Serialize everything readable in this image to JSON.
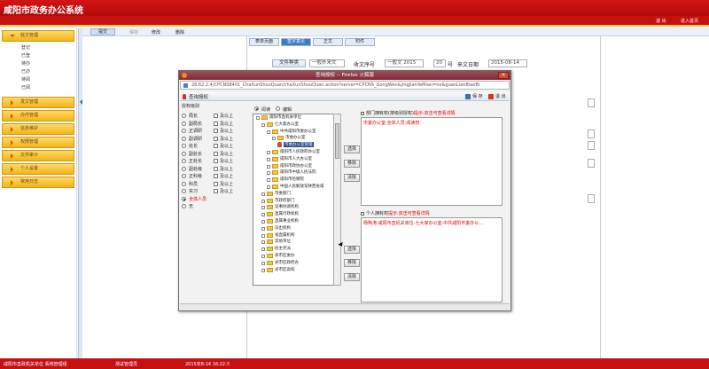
{
  "header": {
    "title": "咸阳市政务办公系统"
  },
  "topbar": {
    "exit": "退 出",
    "home": "进入首页"
  },
  "sidebar": {
    "menus": [
      {
        "label": "收文管理",
        "expanded": true,
        "items": [
          "登记",
          "已登",
          "待办",
          "已办",
          "待阅",
          "已阅"
        ]
      },
      {
        "label": "发文管理",
        "expanded": false
      },
      {
        "label": "办件管理",
        "expanded": false
      },
      {
        "label": "信息维护",
        "expanded": false
      },
      {
        "label": "权限管理",
        "expanded": false
      },
      {
        "label": "文件审计",
        "expanded": false
      },
      {
        "label": "个人设置",
        "expanded": false
      },
      {
        "label": "常用日志",
        "expanded": false
      }
    ]
  },
  "toolbar": {
    "items": [
      "提交",
      "保存",
      "修改",
      "删除"
    ]
  },
  "document": {
    "tabs": [
      "表单页面",
      "签字意见",
      "正文",
      "附件"
    ],
    "doc_type_label": "文件种类",
    "doc_type_value": "一般外来文",
    "doc_no_label": "收文序号",
    "doc_no_value": "一般文 2015",
    "doc_seq": "20",
    "doc_seq_unit": "号",
    "date_label": "来文日期",
    "date_value": "2015-08-14"
  },
  "dialog": {
    "title": "查询授权 -- Firefox 火狐版",
    "url": "28.62.2.4/CPCNS8401_ChaXunShouQuan/chaXunShouQuan.action?server=CPCNS_GongWen&jingjianYeMian=no&guanLianBiaoBi",
    "toolbar_title": "查询授权",
    "save": "保 存",
    "exit": "退 出",
    "levels_title": "授权级别",
    "levels": [
      {
        "left": "局长",
        "right": "及以上"
      },
      {
        "left": "副局长",
        "right": "及以上"
      },
      {
        "left": "正调研",
        "right": "及以上"
      },
      {
        "left": "副调研",
        "right": "及以上"
      },
      {
        "left": "处长",
        "right": "及以上"
      },
      {
        "left": "副处长",
        "right": "及以上"
      },
      {
        "left": "正处长",
        "right": "及以上"
      },
      {
        "left": "副处级",
        "right": "及以上"
      },
      {
        "left": "正科级",
        "right": "及以上"
      },
      {
        "left": "科员",
        "right": "及以上"
      },
      {
        "left": "实习",
        "right": "及以上"
      }
    ],
    "level_all": "全体人员",
    "level_none": "无",
    "mode_read": "阅读",
    "mode_edit": "编辑",
    "tree": [
      "咸阳市直机关单位",
      "七大家办公室",
      "中共咸阳市委办公室",
      "市委办公室",
      "市委办公室管理",
      "咸阳市人民政府办公室",
      "咸阳市人大办公室",
      "咸阳市政协办公室",
      "咸阳市中级人民法院",
      "咸阳市检察院",
      "中国人民解放军陕西省咸",
      "市委部门",
      "市政府部门",
      "议事协调机构",
      "直属行政机构",
      "直属事业机构",
      "派出机构",
      "省直属机构",
      "其他单位",
      "民主党派",
      "县市区委办",
      "县市区政府办",
      "县市区高校"
    ],
    "buttons": {
      "select": "选择",
      "remove": "移除",
      "clear": "清除"
    },
    "dept_header_prefix": "部门拥有权(按级别授权)",
    "dept_header_red": "提示:双击可查看详情",
    "dept_content": "市委办公室:全体人员:阅读权",
    "person_header_prefix": "个人拥有权",
    "person_header_red": "提示:双击可查看详情",
    "person_content": "杨陶涛:咸阳市直机关单位-七大家办公室-中共咸阳市委办公..."
  },
  "status": {
    "org": "咸阳市直政机关单位 系统管理组",
    "user": "测试管理员",
    "time": "2015年8-14 16:22:3"
  }
}
